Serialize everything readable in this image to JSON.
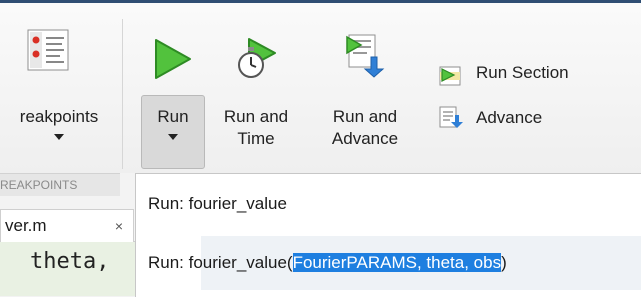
{
  "ribbon": {
    "breakpoints": {
      "label": "reakpoints"
    },
    "run": {
      "label": "Run"
    },
    "run_and_time": {
      "line1": "Run and",
      "line2": "Time"
    },
    "run_and_advance": {
      "line1": "Run and",
      "line2": "Advance"
    },
    "run_section": {
      "label": "Run Section"
    },
    "advance": {
      "label": "Advance"
    },
    "group_label": "REAKPOINTS"
  },
  "editor": {
    "tab_label": "ver.m",
    "tab_close": "×",
    "code_line": "theta,"
  },
  "run_menu": {
    "item1": "Run: fourier_value",
    "item2_prefix": "Run: fourier_value(",
    "item2_args": "FourierPARAMS, theta, obs",
    "item2_suffix": ")"
  },
  "colors": {
    "accent": "#1e7fe0",
    "run_green": "#3aa630",
    "title_bar": "#2f4e73"
  }
}
